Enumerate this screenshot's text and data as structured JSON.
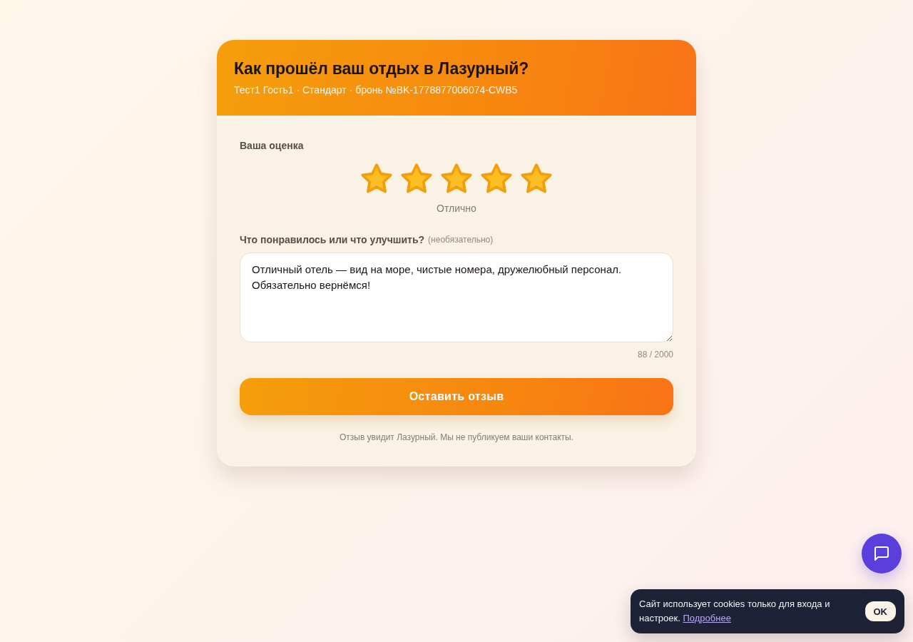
{
  "header": {
    "title": "Как прошёл ваш отдых в Лазурный?",
    "subtitle": "Тест1 Гость1 · Стандарт · бронь №BK-1778877006074-CWB5"
  },
  "rating": {
    "label": "Ваша оценка",
    "stars": 5,
    "caption": "Отлично"
  },
  "review": {
    "label": "Что понравилось или что улучшить?",
    "hint": "(необязательно)",
    "value": "Отличный отель — вид на море, чистые номера, дружелюбный персонал.\nОбязательно вернёмся!",
    "counter": "88 / 2000"
  },
  "submit_button": "Оставить отзыв",
  "note": "Отзыв увидит Лазурный. Мы не публикуем ваши контакты.",
  "cookie_banner": {
    "text": "Сайт использует cookies только для входа и настроек.",
    "link": "Подробнее",
    "button": "OK"
  }
}
